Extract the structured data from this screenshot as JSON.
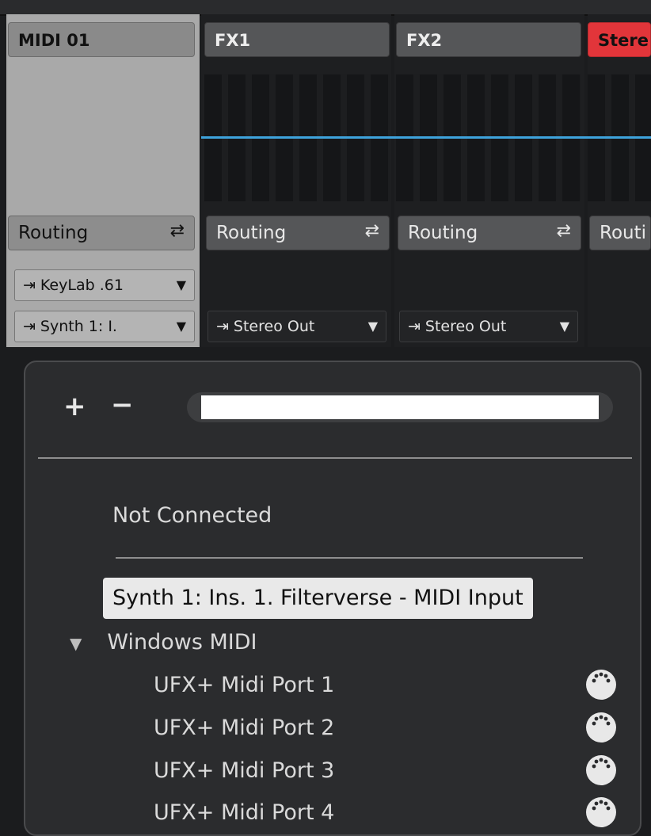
{
  "channels": [
    {
      "name": "MIDI 01",
      "routing": "Routing",
      "input": "KeyLab .61",
      "output": "Synth 1: I."
    },
    {
      "name": "FX1",
      "routing": "Routing",
      "output": "Stereo Out"
    },
    {
      "name": "FX2",
      "routing": "Routing",
      "output": "Stereo Out"
    },
    {
      "name": "Stere",
      "routing": "Routi"
    }
  ],
  "routing_popup": {
    "add_label": "+",
    "remove_label": "−",
    "search_value": "",
    "not_connected": "Not Connected",
    "selected_item": "Synth 1: Ins. 1. Filterverse - MIDI Input",
    "group_name": "Windows MIDI",
    "ports": [
      "UFX+ Midi Port 1",
      "UFX+ Midi Port 2",
      "UFX+ Midi Port 3",
      "UFX+ Midi Port 4"
    ]
  },
  "colors": {
    "accent_blue": "#3ea3dc",
    "stereo_red": "#e2353a",
    "midi_channel_gray": "#a9a9a9"
  },
  "icons": {
    "routing": "routing-icon",
    "input": "input-port-icon",
    "output": "output-port-icon",
    "midi_port": "midi-din-icon"
  }
}
